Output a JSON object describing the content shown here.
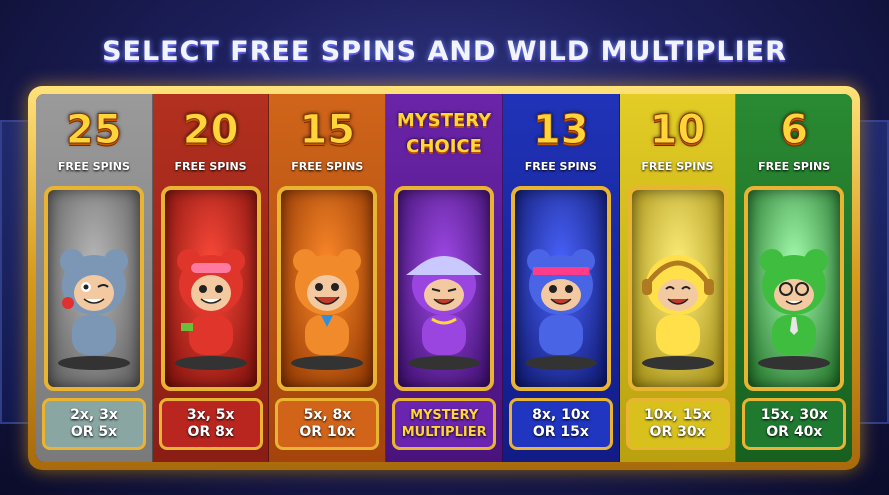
{
  "title": "SELECT FREE SPINS AND WILD MULTIPLIER",
  "options": [
    {
      "label": "25",
      "sub": "FREE SPINS",
      "mult1": "2x, 3x",
      "mult2": "OR 5x",
      "color": "#8d8d8d",
      "panel": "#6e6e6e",
      "box": "#8aa6a3",
      "body": "#7c97b6",
      "accent": "#e03030"
    },
    {
      "label": "20",
      "sub": "FREE SPINS",
      "mult1": "3x, 5x",
      "mult2": "OR 8x",
      "color": "#a8281d",
      "panel": "#c5271d",
      "box": "#b9261f",
      "body": "#e0352a",
      "accent": "#ff7aa0"
    },
    {
      "label": "15",
      "sub": "FREE SPINS",
      "mult1": "5x, 8x",
      "mult2": "OR 10x",
      "color": "#c75d12",
      "panel": "#cf5f15",
      "box": "#d2641a",
      "body": "#f08a2a",
      "accent": "#2e8fe0"
    },
    {
      "label1": "MYSTERY",
      "label2": "CHOICE",
      "mult1": "MYSTERY",
      "mult2": "MULTIPLIER",
      "color": "#5b1d99",
      "panel": "#6a24b0",
      "box": "#6a24b0",
      "body": "#9a45e0",
      "accent": "#c9c9ff"
    },
    {
      "label": "13",
      "sub": "FREE SPINS",
      "mult1": "8x, 10x",
      "mult2": "OR 15x",
      "color": "#1b2bb0",
      "panel": "#2037c5",
      "box": "#2035c0",
      "body": "#4a64e6",
      "accent": "#ff3c8a"
    },
    {
      "label": "10",
      "sub": "FREE SPINS",
      "mult1": "10x, 15x",
      "mult2": "OR 30x",
      "color": "#d9c21b",
      "panel": "#e7d33a",
      "box": "#d9c11d",
      "body": "#ffe04a",
      "accent": "#b07a20"
    },
    {
      "label": "6",
      "sub": "FREE SPINS",
      "mult1": "15x, 30x",
      "mult2": "OR 40x",
      "color": "#237a2c",
      "panel": "#2f9a3a",
      "box": "#1f7a30",
      "body": "#3fbd3f",
      "accent": "#e6e6e6"
    }
  ]
}
